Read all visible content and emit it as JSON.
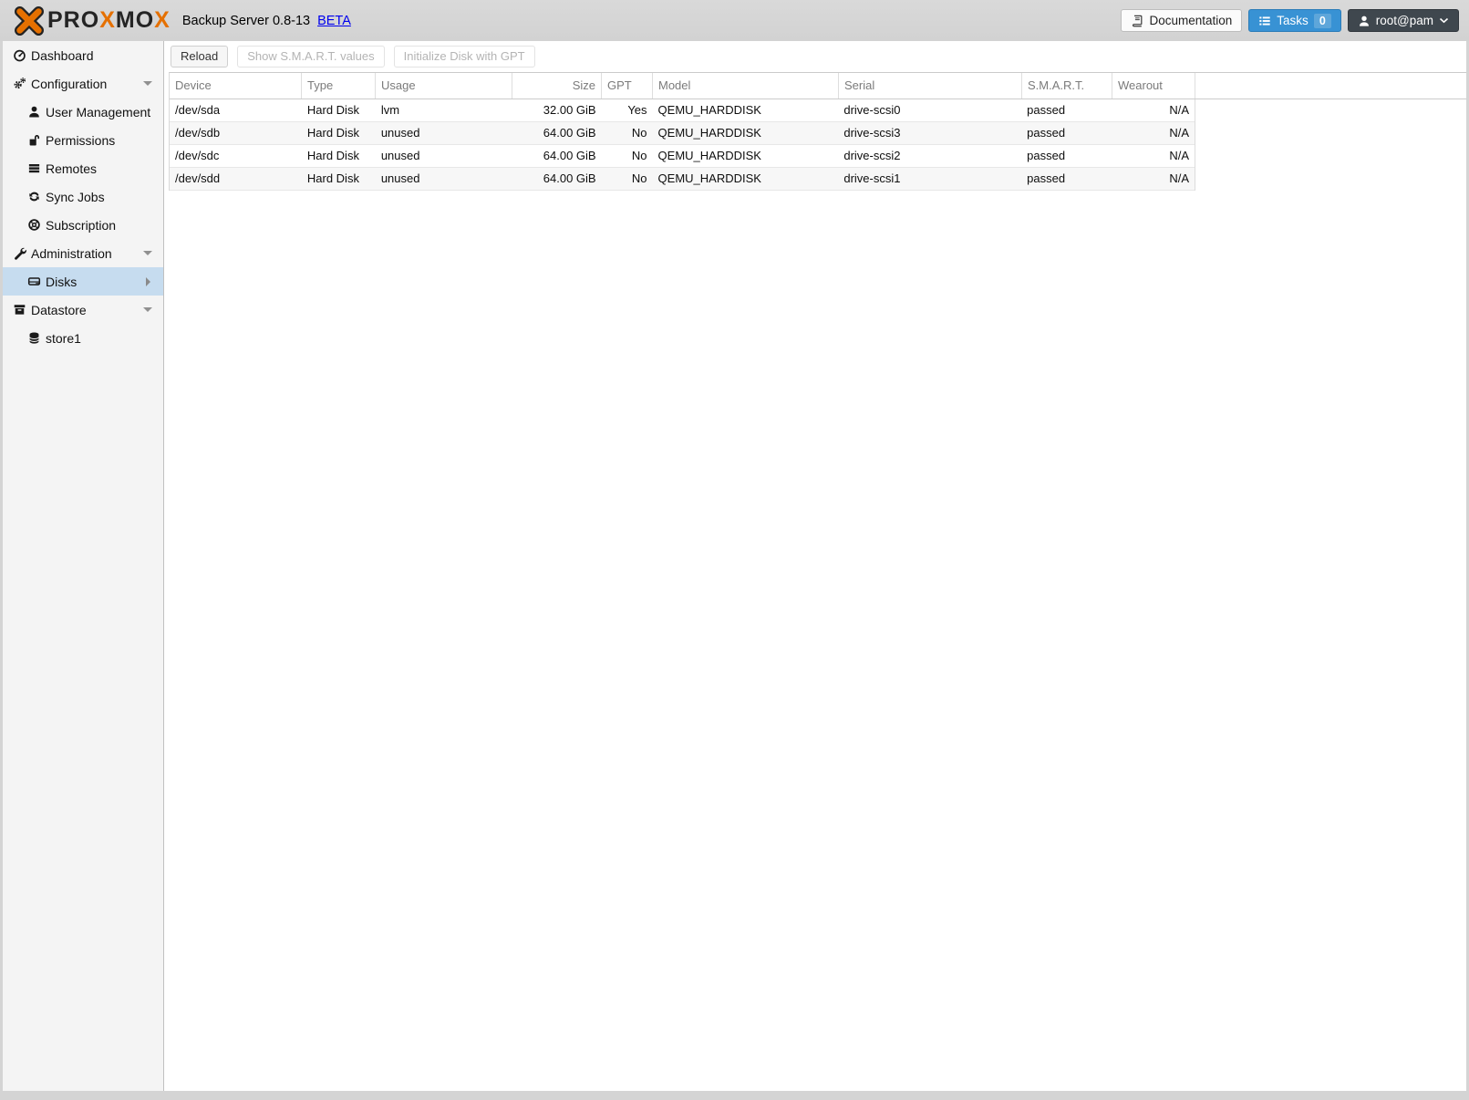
{
  "header": {
    "logo": {
      "seg1": "PRO",
      "seg2": "X",
      "seg3": "MO",
      "seg4": "X"
    },
    "title": "Backup Server 0.8-13",
    "beta": "BETA",
    "documentation": "Documentation",
    "tasks": "Tasks",
    "tasks_count": "0",
    "user": "root@pam"
  },
  "sidebar": {
    "items": [
      {
        "label": "Dashboard",
        "icon": "dashboard-icon"
      },
      {
        "label": "Configuration",
        "icon": "gears-icon"
      },
      {
        "label": "User Management",
        "icon": "user-icon"
      },
      {
        "label": "Permissions",
        "icon": "unlock-icon"
      },
      {
        "label": "Remotes",
        "icon": "list-icon"
      },
      {
        "label": "Sync Jobs",
        "icon": "refresh-icon"
      },
      {
        "label": "Subscription",
        "icon": "life-ring-icon"
      },
      {
        "label": "Administration",
        "icon": "wrench-icon"
      },
      {
        "label": "Disks",
        "icon": "hdd-icon"
      },
      {
        "label": "Datastore",
        "icon": "archive-icon"
      },
      {
        "label": "store1",
        "icon": "database-icon"
      }
    ]
  },
  "toolbar": {
    "reload": "Reload",
    "smart": "Show S.M.A.R.T. values",
    "init_gpt": "Initialize Disk with GPT"
  },
  "table": {
    "columns": [
      "Device",
      "Type",
      "Usage",
      "Size",
      "GPT",
      "Model",
      "Serial",
      "S.M.A.R.T.",
      "Wearout"
    ],
    "rows": [
      [
        "/dev/sda",
        "Hard Disk",
        "lvm",
        "32.00 GiB",
        "Yes",
        "QEMU_HARDDISK",
        "drive-scsi0",
        "passed",
        "N/A"
      ],
      [
        "/dev/sdb",
        "Hard Disk",
        "unused",
        "64.00 GiB",
        "No",
        "QEMU_HARDDISK",
        "drive-scsi3",
        "passed",
        "N/A"
      ],
      [
        "/dev/sdc",
        "Hard Disk",
        "unused",
        "64.00 GiB",
        "No",
        "QEMU_HARDDISK",
        "drive-scsi2",
        "passed",
        "N/A"
      ],
      [
        "/dev/sdd",
        "Hard Disk",
        "unused",
        "64.00 GiB",
        "No",
        "QEMU_HARDDISK",
        "drive-scsi1",
        "passed",
        "N/A"
      ]
    ]
  },
  "colors": {
    "brand_orange": "#E57000",
    "tasks_blue": "#3892d4",
    "user_button_dark": "#3f474e",
    "selected_nav_blue": "#c6dcef",
    "link_blue": "#0000EE",
    "smart_status": "passed"
  }
}
